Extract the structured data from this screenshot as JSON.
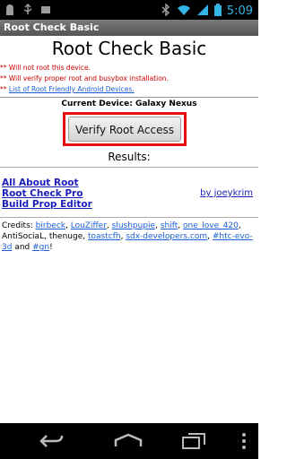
{
  "status_bar": {
    "time": "5:09"
  },
  "app_bar": {
    "title": "Root Check Basic"
  },
  "main": {
    "title": "Root Check Basic",
    "notes": [
      {
        "bullet": "**",
        "text": "Will not root this device."
      },
      {
        "bullet": "**",
        "text": "Will verify proper root and busybox installation."
      },
      {
        "bullet": "**",
        "text": "List of Root Friendly Android Devices."
      }
    ],
    "current_device": "Current Device: Galaxy Nexus",
    "verify_button": "Verify Root Access",
    "results_label": "Results:",
    "links": [
      "All About Root",
      "Root Check Pro",
      "Build Prop Editor"
    ],
    "author": "by joeykrim",
    "credits_label": "Credits:",
    "credits": [
      "birbeck",
      "LouZiffer",
      "slushpupie",
      "shift",
      "one_love_420",
      "AntiSociaL",
      "thenuge",
      "toastcfh",
      "sdx-developers.com",
      "#htc-evo-3d",
      "and",
      "#gn",
      "!"
    ]
  },
  "colors": {
    "accent": "#33b5e5",
    "warning": "#cc0000",
    "link": "#1a1fb8",
    "highlight": "#e01010"
  }
}
